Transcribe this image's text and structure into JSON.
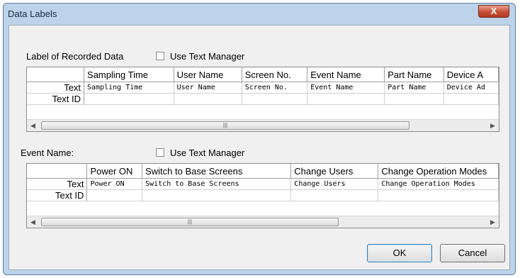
{
  "window": {
    "title": "Data Labels",
    "close_label": "X"
  },
  "recorded": {
    "section_label": "Label of Recorded Data",
    "use_text_manager": "Use Text Manager",
    "columns": [
      "Sampling Time",
      "User Name",
      "Screen No.",
      "Event Name",
      "Part Name",
      "Device A"
    ],
    "rows": [
      {
        "label": "Text",
        "cells": [
          "Sampling Time",
          "User Name",
          "Screen No.",
          "Event Name",
          "Part Name",
          "Device Ad"
        ]
      },
      {
        "label": "Text ID",
        "cells": [
          "",
          "",
          "",
          "",
          "",
          ""
        ]
      }
    ]
  },
  "event": {
    "section_label": "Event Name:",
    "use_text_manager": "Use Text Manager",
    "columns": [
      "Power ON",
      "Switch to Base Screens",
      "Change Users",
      "Change Operation Modes"
    ],
    "rows": [
      {
        "label": "Text",
        "cells": [
          "Power ON",
          "Switch to Base Screens",
          "Change Users",
          "Change Operation Modes"
        ]
      },
      {
        "label": "Text ID",
        "cells": [
          "",
          "",
          "",
          ""
        ]
      }
    ]
  },
  "buttons": {
    "ok": "OK",
    "cancel": "Cancel"
  }
}
